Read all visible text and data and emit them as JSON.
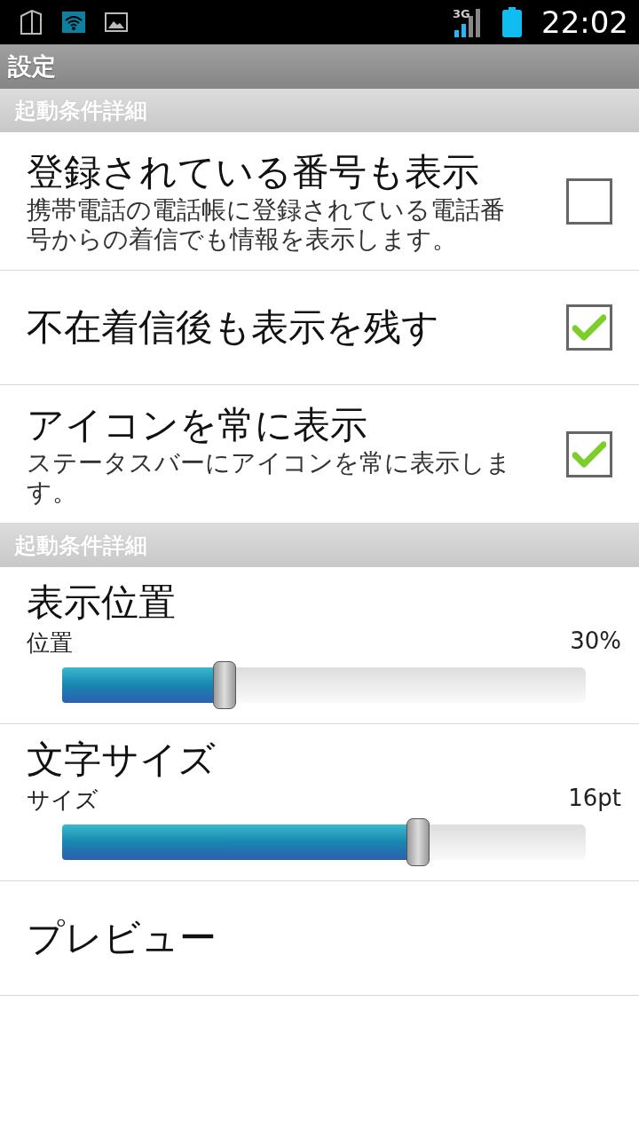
{
  "status_bar": {
    "time": "22:02",
    "network": "3G"
  },
  "title": "設定",
  "sections": [
    {
      "header": "起動条件詳細",
      "items": [
        {
          "kind": "checkbox",
          "title": "登録されている番号も表示",
          "summary": "携帯電話の電話帳に登録されている電話番号からの着信でも情報を表示します。",
          "checked": false
        },
        {
          "kind": "checkbox",
          "title": "不在着信後も表示を残す",
          "checked": true
        },
        {
          "kind": "checkbox",
          "title": "アイコンを常に表示",
          "summary": "ステータスバーにアイコンを常に表示します。",
          "checked": true
        }
      ]
    },
    {
      "header": "起動条件詳細",
      "items": [
        {
          "kind": "slider",
          "title": "表示位置",
          "label": "位置",
          "reading": "30%",
          "level": 0.31
        },
        {
          "kind": "slider",
          "title": "文字サイズ",
          "label": "サイズ",
          "reading": "16pt",
          "level": 0.68
        },
        {
          "kind": "plain",
          "title": "プレビュー"
        }
      ]
    }
  ]
}
